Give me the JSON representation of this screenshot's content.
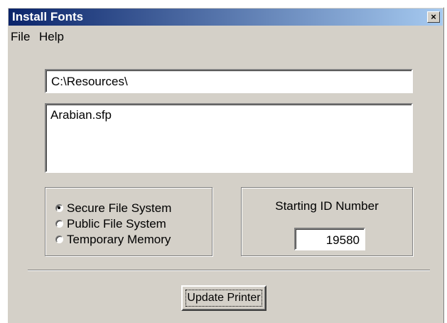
{
  "window": {
    "title": "Install Fonts",
    "close_label": "×"
  },
  "menu": {
    "items": [
      "File",
      "Help"
    ]
  },
  "path_field": {
    "value": "C:\\Resources\\"
  },
  "file_list": {
    "items": [
      "Arabian.sfp"
    ]
  },
  "storage": {
    "options": [
      "Secure File System",
      "Public File System",
      "Temporary Memory"
    ],
    "selected": "Secure File System"
  },
  "starting_id": {
    "label": "Starting ID Number",
    "value": "19580"
  },
  "actions": {
    "update_label": "Update Printer"
  }
}
